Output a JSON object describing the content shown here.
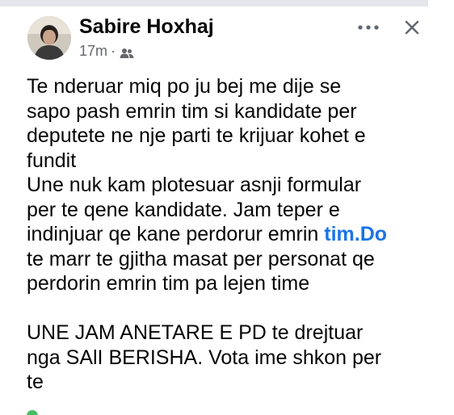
{
  "post": {
    "author": "Sabire Hoxhaj",
    "time": "17m",
    "audience_icon": "friends-icon",
    "more_icon": "more-icon",
    "close_icon": "close-icon",
    "lines_part1": [
      "Te nderuar miq po ju bej me dije se",
      "sapo pash emrin tim si kandidate per",
      "deputete ne nje parti te krijuar kohet e",
      "fundit",
      "Une nuk kam plotesuar asnji formular",
      "per te qene kandidate. Jam teper e"
    ],
    "line_with_link_prefix": "indinjuar qe  kane perdorur emrin ",
    "line_with_link_link": "tim.Do",
    "lines_part2": [
      "te marr te gjitha masat per personat qe",
      "perdorin emrin tim pa lejen time"
    ],
    "lines_part3": [
      "UNE JAM ANETARE E PD te drejtuar",
      "nga SAlI BERISHA. Vota ime shkon per",
      "te"
    ]
  },
  "colors": {
    "link": "#1b74e4",
    "meta": "#65676b",
    "text": "#050505"
  }
}
